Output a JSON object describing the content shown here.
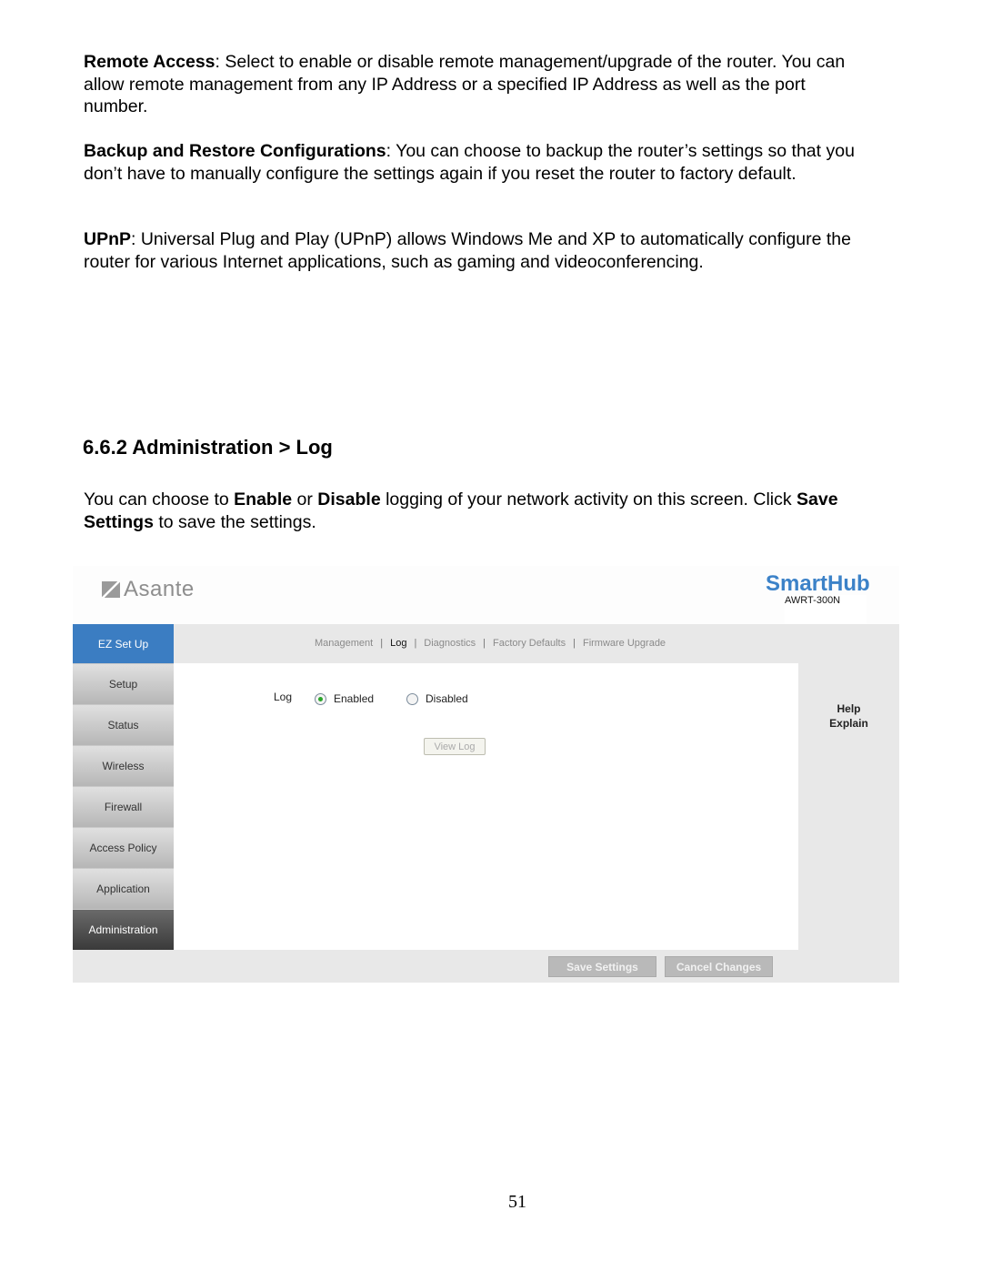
{
  "doc": {
    "paragraphs": [
      {
        "bold": "Remote Access",
        "text": ": Select to enable or disable remote management/upgrade of the router. You can allow remote management from any IP Address or a specified IP Address as well as the port number."
      },
      {
        "bold": "Backup and Restore Configurations",
        "text": ": You can choose to backup the router’s settings so that you don’t have to manually configure the settings again if you reset the router to factory default."
      },
      {
        "bold": "UPnP",
        "text": ": Universal Plug and Play (UPnP) allows Windows Me and XP to automatically configure the router for various Internet applications, such as gaming and videoconferencing."
      }
    ],
    "section_heading": "6.6.2 Administration > Log",
    "intro": {
      "t1": "You can choose to ",
      "b1": "Enable",
      "t2": " or ",
      "b2": "Disable",
      "t3": " logging of your network activity on this screen. Click ",
      "b3": "Save Settings",
      "t4": " to save the settings."
    },
    "page_number": "51"
  },
  "router_ui": {
    "logo": "Asante",
    "brand": "SmartHub",
    "model": "AWRT-300N",
    "sidebar": [
      "EZ Set Up",
      "Setup",
      "Status",
      "Wireless",
      "Firewall",
      "Access Policy",
      "Application",
      "Administration"
    ],
    "active_sidebar": "Administration",
    "subnav": [
      "Management",
      "Log",
      "Diagnostics",
      "Factory Defaults",
      "Firmware Upgrade"
    ],
    "active_subnav": "Log",
    "log_label": "Log",
    "radio_enabled": "Enabled",
    "radio_disabled": "Disabled",
    "log_state": "Enabled",
    "view_log_button": "View Log",
    "help_title": "Help",
    "help_link": "Explain",
    "save_button": "Save Settings",
    "cancel_button": "Cancel Changes",
    "colors": {
      "ez_setup": "#3b7dc2",
      "brand": "#3c82c8",
      "active_sidebar": "#4a4a4a"
    }
  }
}
